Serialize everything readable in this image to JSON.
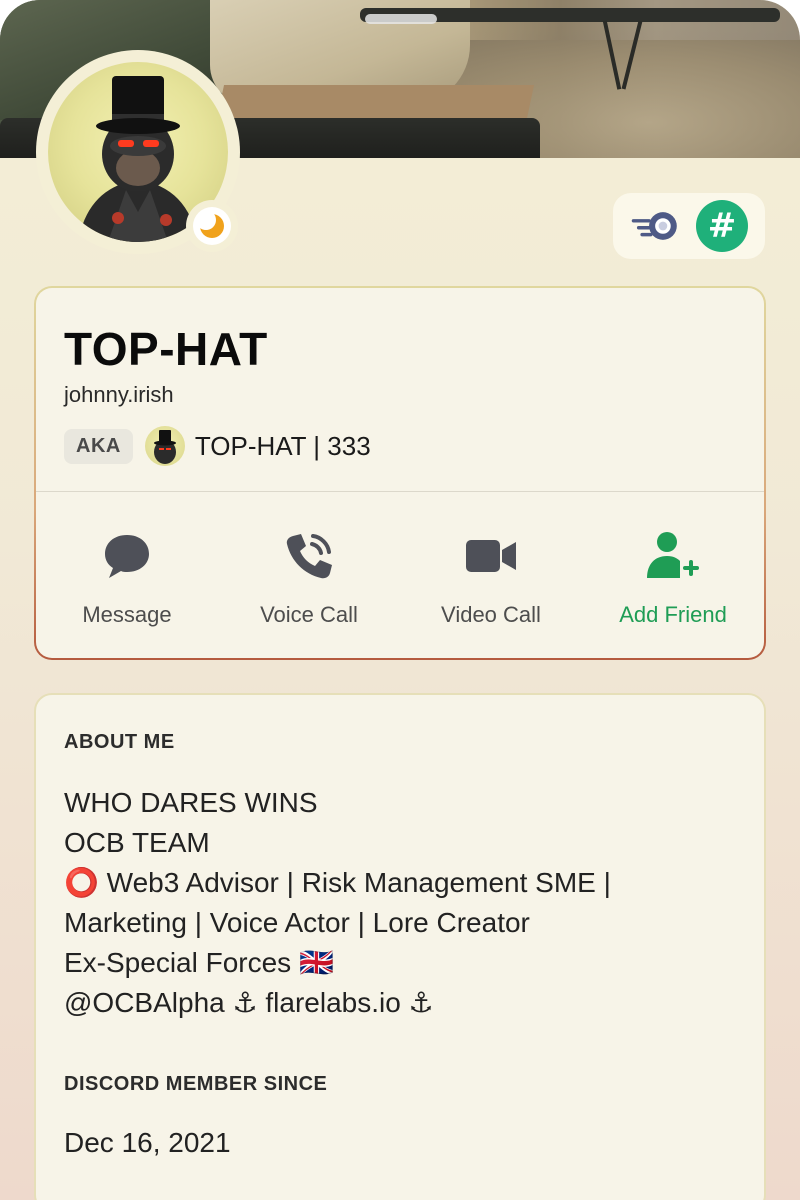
{
  "profile": {
    "display_name": "TOP-HAT",
    "username": "johnny.irish",
    "aka_label": "AKA",
    "aka_name": "TOP-HAT | 333",
    "status": "idle"
  },
  "badges": [
    {
      "name": "nitro-badge-icon"
    },
    {
      "name": "hash-badge-icon",
      "glyph": "#"
    }
  ],
  "actions": [
    {
      "label": "Message",
      "icon": "message-icon"
    },
    {
      "label": "Voice Call",
      "icon": "phone-icon"
    },
    {
      "label": "Video Call",
      "icon": "video-camera-icon"
    },
    {
      "label": "Add Friend",
      "icon": "add-friend-icon"
    }
  ],
  "about": {
    "title": "ABOUT ME",
    "lines": [
      "WHO DARES WINS",
      "OCB TEAM",
      "⭕ Web3 Advisor | Risk Management SME |",
      "Marketing | Voice Actor | Lore Creator",
      "Ex-Special Forces 🇬🇧",
      "@OCBAlpha ⚓ flarelabs.io ⚓"
    ]
  },
  "member_since": {
    "title": "DISCORD MEMBER SINCE",
    "date": "Dec 16, 2021"
  },
  "colors": {
    "accent_green": "#1f9d55",
    "idle_orange": "#f0a21c",
    "hash_badge": "#1fb07a",
    "icon_gray": "#4e5058"
  }
}
